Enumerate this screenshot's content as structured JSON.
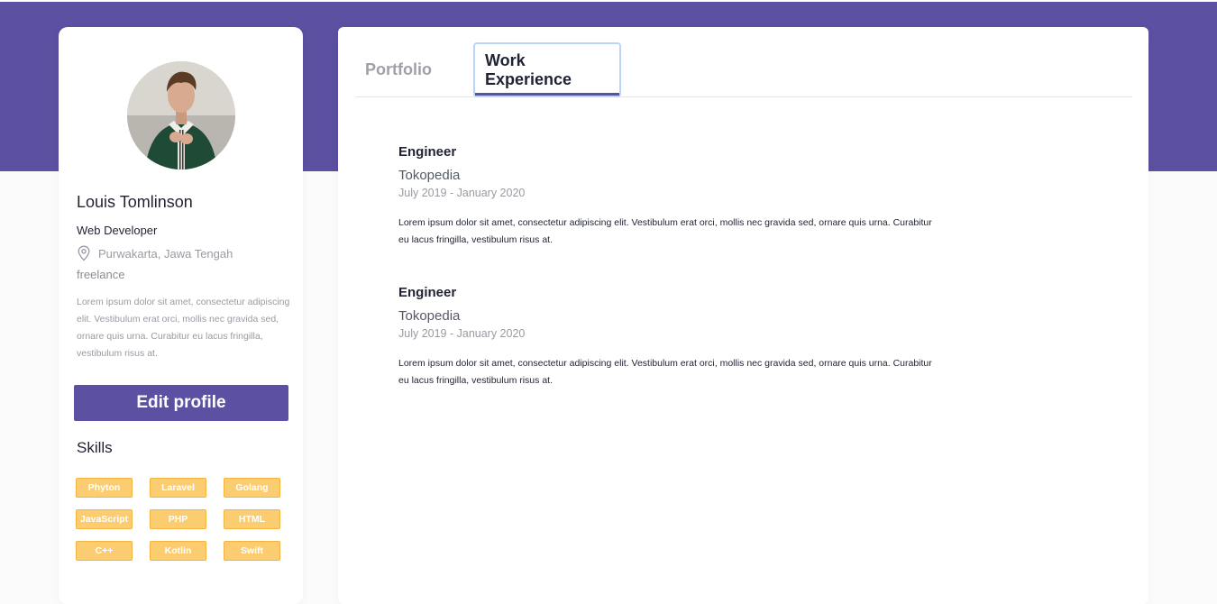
{
  "colors": {
    "brand": "#5b50a1",
    "skill_tag_bg": "#fccd70",
    "skill_tag_border": "#f4b33f",
    "focus_ring": "#bcd4fb"
  },
  "profile": {
    "avatar_alt": "profile photo",
    "name": "Louis Tomlinson",
    "role": "Web Developer",
    "location_icon": "map-pin-icon",
    "location": "Purwakarta, Jawa Tengah",
    "job_type": "freelance",
    "bio": "Lorem ipsum dolor sit amet, consectetur adipiscing elit. Vestibulum erat orci, mollis nec gravida sed, ornare quis urna. Curabitur eu lacus fringilla, vestibulum risus at.",
    "edit_button": "Edit profile",
    "skills_title": "Skills",
    "skills": [
      "Phyton",
      "Laravel",
      "Golang",
      "JavaScript",
      "PHP",
      "HTML",
      "C++",
      "Kotlin",
      "Swift"
    ]
  },
  "tabs": {
    "portfolio": "Portfolio",
    "work_experience": "Work Experience",
    "active": "work_experience"
  },
  "experiences": [
    {
      "title": "Engineer",
      "company": "Tokopedia",
      "period": "July 2019 - January 2020",
      "description": "Lorem ipsum dolor sit amet, consectetur adipiscing elit. Vestibulum erat orci, mollis nec gravida sed, ornare quis urna. Curabitur eu lacus fringilla, vestibulum risus at."
    },
    {
      "title": "Engineer",
      "company": "Tokopedia",
      "period": "July 2019 - January 2020",
      "description": "Lorem ipsum dolor sit amet, consectetur adipiscing elit. Vestibulum erat orci, mollis nec gravida sed, ornare quis urna. Curabitur eu lacus fringilla, vestibulum risus at."
    }
  ]
}
